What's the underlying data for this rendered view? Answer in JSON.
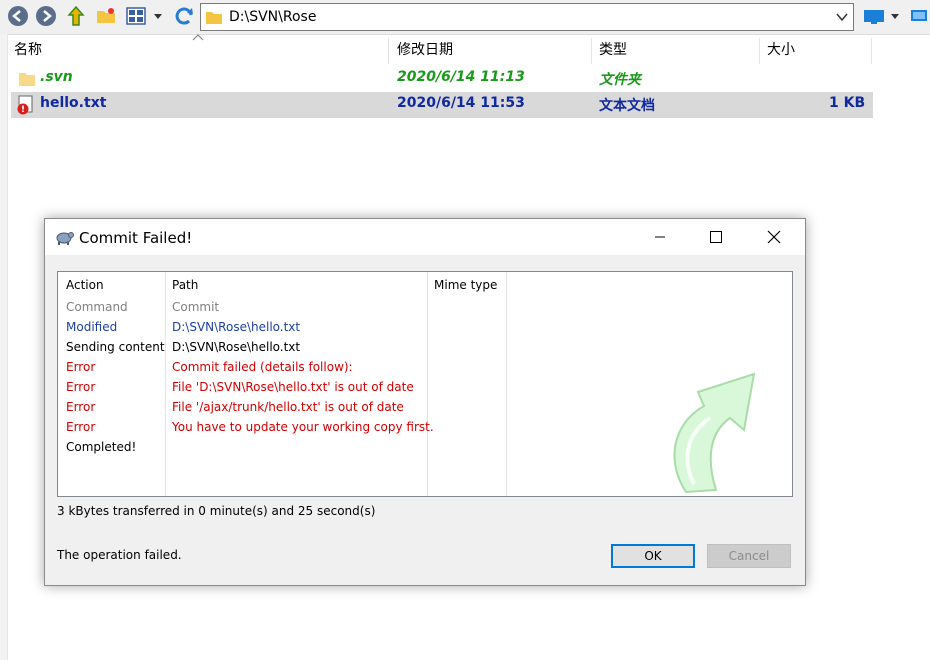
{
  "explorer": {
    "address": "D:\\SVN\\Rose",
    "columns": [
      "名称",
      "修改日期",
      "类型",
      "大小"
    ],
    "rows": [
      {
        "name": ".svn",
        "date": "2020/6/14 11:13",
        "type": "文件夹",
        "size": ""
      },
      {
        "name": "hello.txt",
        "date": "2020/6/14 11:53",
        "type": "文本文档",
        "size": "1 KB"
      }
    ]
  },
  "dialog": {
    "title": "Commit Failed!",
    "headers": {
      "action": "Action",
      "path": "Path",
      "mime": "Mime type"
    },
    "log": [
      {
        "action": "Command",
        "path": "Commit",
        "color": "#808080"
      },
      {
        "action": "Modified",
        "path": "D:\\SVN\\Rose\\hello.txt",
        "color": "#1c3fa0"
      },
      {
        "action": "Sending content",
        "path": "D:\\SVN\\Rose\\hello.txt",
        "color": "#000000"
      },
      {
        "action": "Error",
        "path": "Commit failed (details follow):",
        "color": "#d00000"
      },
      {
        "action": "Error",
        "path": "File 'D:\\SVN\\Rose\\hello.txt' is out of date",
        "color": "#d00000"
      },
      {
        "action": "Error",
        "path": "File '/ajax/trunk/hello.txt' is out of date",
        "color": "#d00000"
      },
      {
        "action": "Error",
        "path": "You have to update your working copy first.",
        "color": "#d00000"
      },
      {
        "action": "Completed!",
        "path": "",
        "color": "#000000"
      }
    ],
    "transfer": "3 kBytes transferred in 0 minute(s) and 25 second(s)",
    "status": "The operation failed.",
    "ok_label": "OK",
    "cancel_label": "Cancel"
  },
  "colors": {
    "accent": "#0078d7",
    "error": "#d00000",
    "folder_green": "#1a9a1a",
    "file_blue": "#1028a0"
  }
}
